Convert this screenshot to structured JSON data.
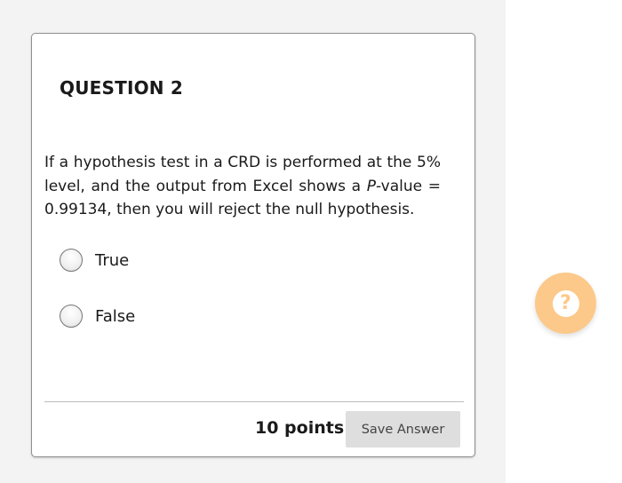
{
  "question": {
    "title": "QUESTION 2",
    "text_before": "If a hypothesis test in a CRD is performed at the 5% level, and the output from Excel shows a ",
    "text_italic": "P",
    "text_after": "-value = 0.99134, then you will reject the null hypothesis.",
    "options": [
      {
        "label": "True",
        "selected": false
      },
      {
        "label": "False",
        "selected": false
      }
    ],
    "points": "10 points",
    "save_label": "Save Answer"
  },
  "help": {
    "icon": "question-mark-icon",
    "glyph": "?",
    "color": "#fcc98a"
  },
  "colors": {
    "page_background": "#f3f3f3",
    "card_background": "#ffffff",
    "button_background": "#dedede"
  }
}
